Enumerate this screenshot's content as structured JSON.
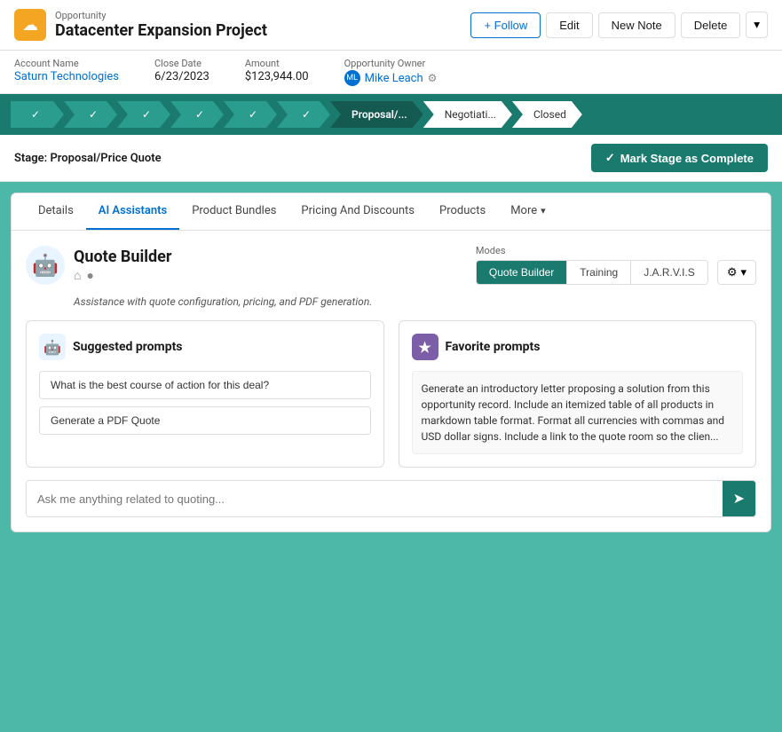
{
  "header": {
    "logo_icon": "☁",
    "object_type": "Opportunity",
    "title": "Datacenter Expansion Project",
    "follow_label": "+ Follow",
    "edit_label": "Edit",
    "new_note_label": "New Note",
    "delete_label": "Delete",
    "dropdown_icon": "▾"
  },
  "meta": {
    "account_label": "Account Name",
    "account_value": "Saturn Technologies",
    "close_date_label": "Close Date",
    "close_date_value": "6/23/2023",
    "amount_label": "Amount",
    "amount_value": "$123,944.00",
    "owner_label": "Opportunity Owner",
    "owner_name": "Mike Leach",
    "owner_icon": "ML"
  },
  "pipeline": {
    "stages": [
      {
        "label": "✓",
        "state": "completed"
      },
      {
        "label": "✓",
        "state": "completed"
      },
      {
        "label": "✓",
        "state": "completed"
      },
      {
        "label": "✓",
        "state": "completed"
      },
      {
        "label": "✓",
        "state": "completed"
      },
      {
        "label": "✓",
        "state": "completed"
      },
      {
        "label": "Proposal/...",
        "state": "active"
      },
      {
        "label": "Negotiati...",
        "state": "inactive"
      },
      {
        "label": "Closed",
        "state": "inactive"
      }
    ]
  },
  "stage_bar": {
    "stage_label": "Stage: Proposal/Price Quote",
    "complete_btn": "Mark Stage as Complete",
    "checkmark": "✓"
  },
  "tabs": {
    "items": [
      {
        "label": "Details",
        "active": false
      },
      {
        "label": "AI Assistants",
        "active": true
      },
      {
        "label": "Product Bundles",
        "active": false
      },
      {
        "label": "Pricing And Discounts",
        "active": false
      },
      {
        "label": "Products",
        "active": false
      },
      {
        "label": "More",
        "active": false
      }
    ]
  },
  "ai_panel": {
    "avatar": "🤖",
    "name": "Quote Builder",
    "home_icon": "⌂",
    "chat_icon": "●",
    "modes_label": "Modes",
    "mode_buttons": [
      {
        "label": "Quote Builder",
        "active": true
      },
      {
        "label": "Training",
        "active": false
      },
      {
        "label": "J.A.R.V.I.S",
        "active": false
      }
    ],
    "gear_icon": "⚙",
    "dropdown_icon": "▾",
    "description": "Assistance with quote configuration, pricing, and PDF generation.",
    "suggested_title": "Suggested prompts",
    "suggested_icon": "🤖",
    "favorite_title": "Favorite prompts",
    "favorite_icon": "★",
    "suggested_prompts": [
      "What is the best course of action for this deal?",
      "Generate a PDF Quote"
    ],
    "favorite_text": "Generate an introductory letter proposing a solution from this opportunity record. Include an itemized table of all products in markdown table format. Format all currencies with commas and USD dollar signs. Include a link to the quote room so the clien...",
    "ask_placeholder": "Ask me anything related to quoting...",
    "send_icon": "➤"
  }
}
